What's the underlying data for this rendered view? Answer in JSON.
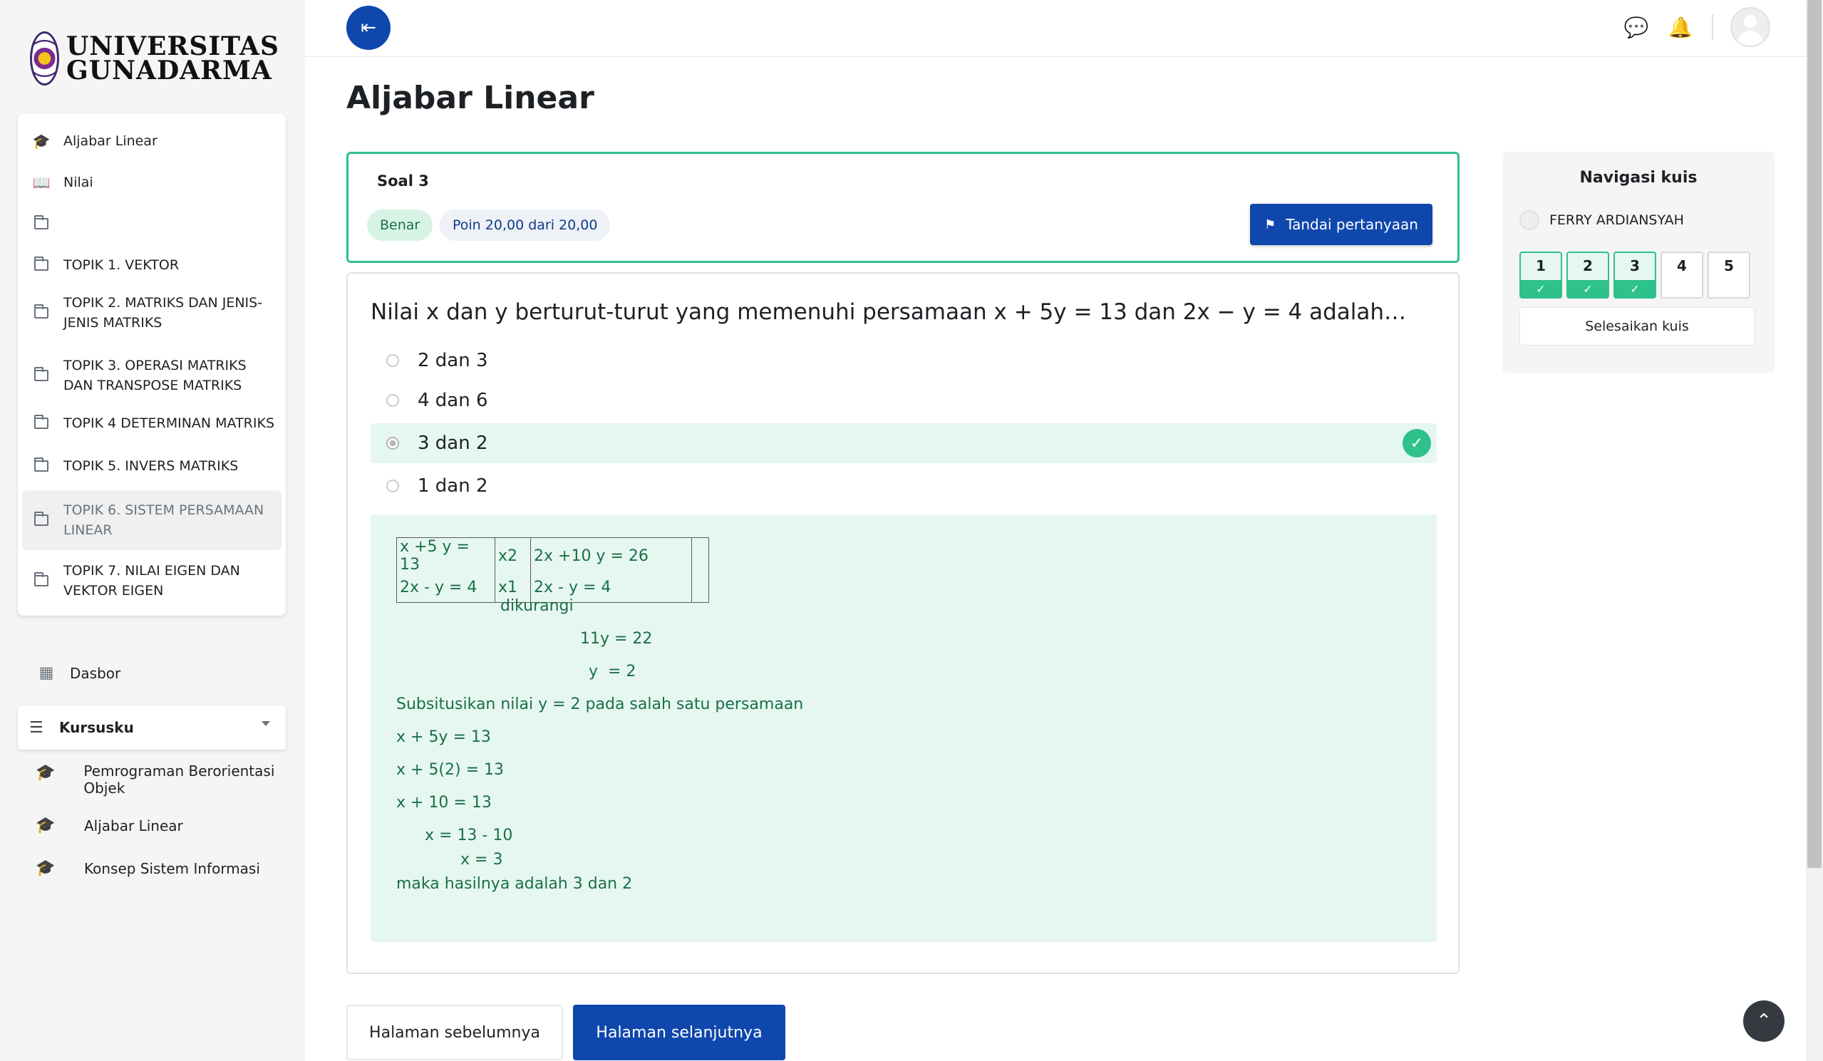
{
  "brand": {
    "line1": "UNIVERSITAS",
    "line2": "GUNADARMA"
  },
  "course_nav": {
    "items": [
      {
        "label": "Aljabar Linear",
        "icon": "graduation-cap-icon"
      },
      {
        "label": "Nilai",
        "icon": "book-open-icon"
      },
      {
        "label": "",
        "icon": "folder-icon"
      },
      {
        "label": "TOPIK 1. VEKTOR",
        "icon": "folder-icon"
      },
      {
        "label": "TOPIK 2. MATRIKS DAN JENIS-JENIS MATRIKS",
        "icon": "folder-icon"
      },
      {
        "label": "TOPIK 3. OPERASI MATRIKS DAN TRANSPOSE MATRIKS",
        "icon": "folder-icon"
      },
      {
        "label": "TOPIK 4 DETERMINAN MATRIKS",
        "icon": "folder-icon"
      },
      {
        "label": "TOPIK 5. INVERS MATRIKS",
        "icon": "folder-icon"
      },
      {
        "label": "TOPIK 6. SISTEM PERSAMAAN LINEAR",
        "icon": "folder-icon"
      },
      {
        "label": "TOPIK 7. NILAI EIGEN DAN VEKTOR EIGEN",
        "icon": "folder-icon"
      }
    ]
  },
  "sidebar": {
    "dasbor": "Dasbor",
    "kursusku": "Kursusku",
    "my_courses": [
      {
        "label": "Pemrograman Berorientasi Objek"
      },
      {
        "label": "Aljabar Linear"
      },
      {
        "label": "Konsep Sistem Informasi"
      }
    ]
  },
  "page": {
    "title": "Aljabar Linear"
  },
  "question": {
    "number_label": "Soal 3",
    "status_badge": "Benar",
    "points_badge": "Poin 20,00 dari 20,00",
    "flag_button": "Tandai pertanyaan",
    "text": "Nilai x dan y berturut-turut yang memenuhi persamaan x + 5y = 13 dan 2x − y = 4 adalah…",
    "answers": [
      {
        "label": "2 dan 3",
        "selected": false
      },
      {
        "label": "4 dan 6",
        "selected": false
      },
      {
        "label": "3 dan 2",
        "selected": true
      },
      {
        "label": "1 dan 2",
        "selected": false
      }
    ],
    "feedback": {
      "table": [
        [
          "x +5 y = 13",
          "x2",
          "2x +10 y = 26",
          ""
        ],
        [
          "2x - y = 4",
          "x1",
          "2x - y = 4",
          ""
        ]
      ],
      "lines": [
        "dikurangi",
        "11y = 22",
        "y  = 2",
        "Subsitusikan nilai y = 2 pada salah satu persamaan",
        "x + 5y = 13",
        "x + 5(2) = 13",
        "x + 10 = 13",
        "x = 13 - 10",
        "x = 3",
        "maka hasilnya adalah 3 dan 2"
      ]
    }
  },
  "footer_nav": {
    "prev": "Halaman sebelumnya",
    "next": "Halaman selanjutnya"
  },
  "quiz_nav": {
    "title": "Navigasi kuis",
    "user": "FERRY ARDIANSYAH",
    "questions": [
      {
        "num": "1",
        "answered": true
      },
      {
        "num": "2",
        "answered": true
      },
      {
        "num": "3",
        "answered": true
      },
      {
        "num": "4",
        "answered": false
      },
      {
        "num": "5",
        "answered": false
      }
    ],
    "finish": "Selesaikan kuis"
  },
  "colors": {
    "primary": "#0f47ad",
    "success": "#2fc18c",
    "success_bg": "#e6f7ef"
  }
}
